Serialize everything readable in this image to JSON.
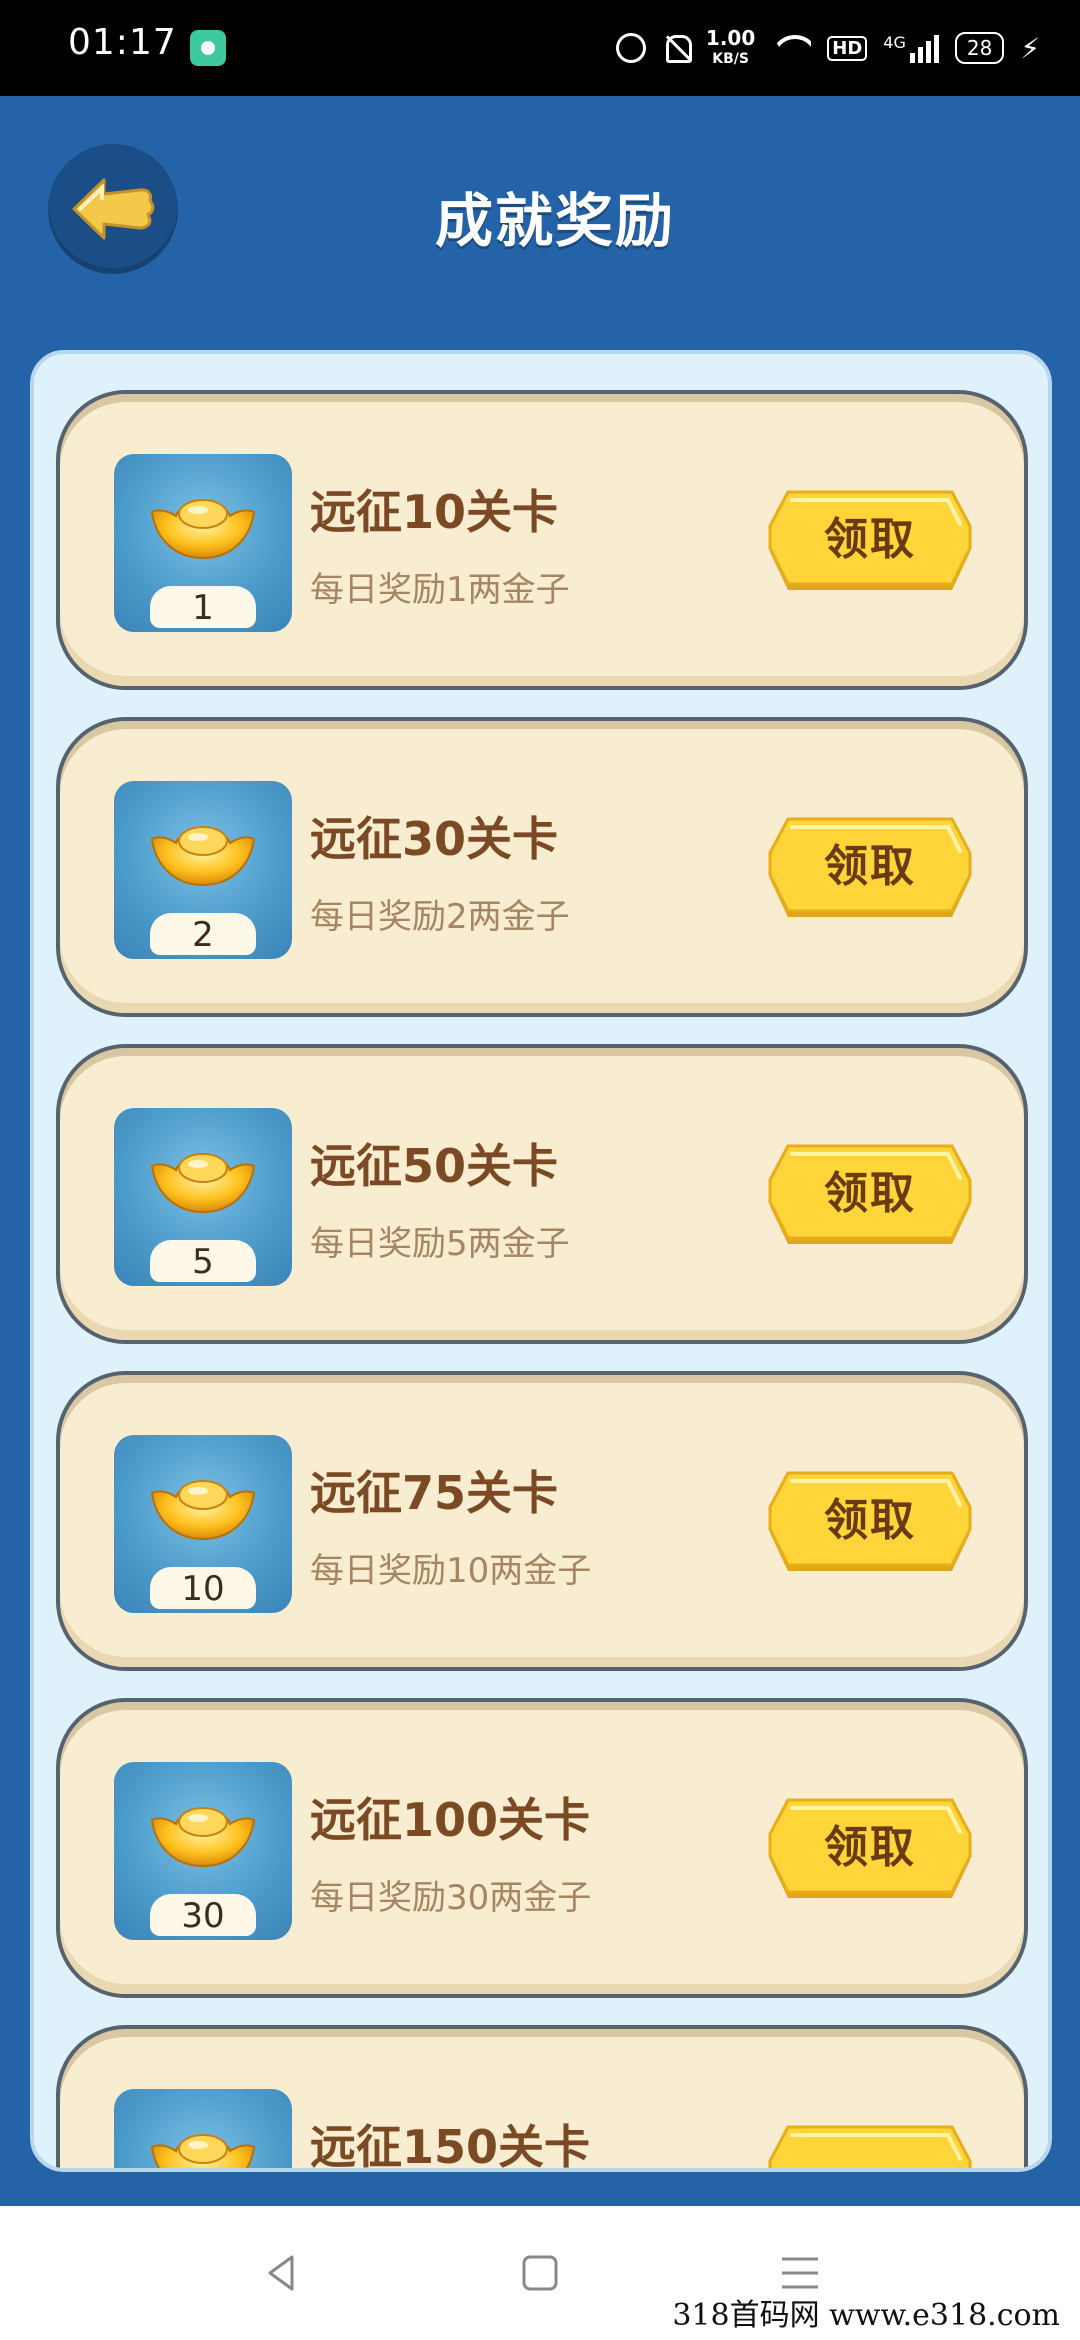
{
  "status_bar": {
    "time": "01:17",
    "speed_value": "1.00",
    "speed_unit": "KB/S",
    "hd": "HD",
    "network": "4G",
    "battery": "28"
  },
  "header": {
    "title": "成就奖励",
    "back_icon": "arrow-left-icon"
  },
  "rewards": [
    {
      "title": "远征10关卡",
      "subtitle": "每日奖励1两金子",
      "count": "1",
      "button": "领取"
    },
    {
      "title": "远征30关卡",
      "subtitle": "每日奖励2两金子",
      "count": "2",
      "button": "领取"
    },
    {
      "title": "远征50关卡",
      "subtitle": "每日奖励5两金子",
      "count": "5",
      "button": "领取"
    },
    {
      "title": "远征75关卡",
      "subtitle": "每日奖励10两金子",
      "count": "10",
      "button": "领取"
    },
    {
      "title": "远征100关卡",
      "subtitle": "每日奖励30两金子",
      "count": "30",
      "button": "领取"
    },
    {
      "title": "远征150关卡",
      "subtitle": "",
      "count": "",
      "button": ""
    }
  ],
  "watermark": "318首码网 www.e318.com",
  "colors": {
    "background": "#2463a8",
    "panel": "#dff1fb",
    "card": "#f8edd0",
    "title_text": "#7b4a25",
    "subtitle_text": "#a58563",
    "button": "#ffd23a"
  }
}
